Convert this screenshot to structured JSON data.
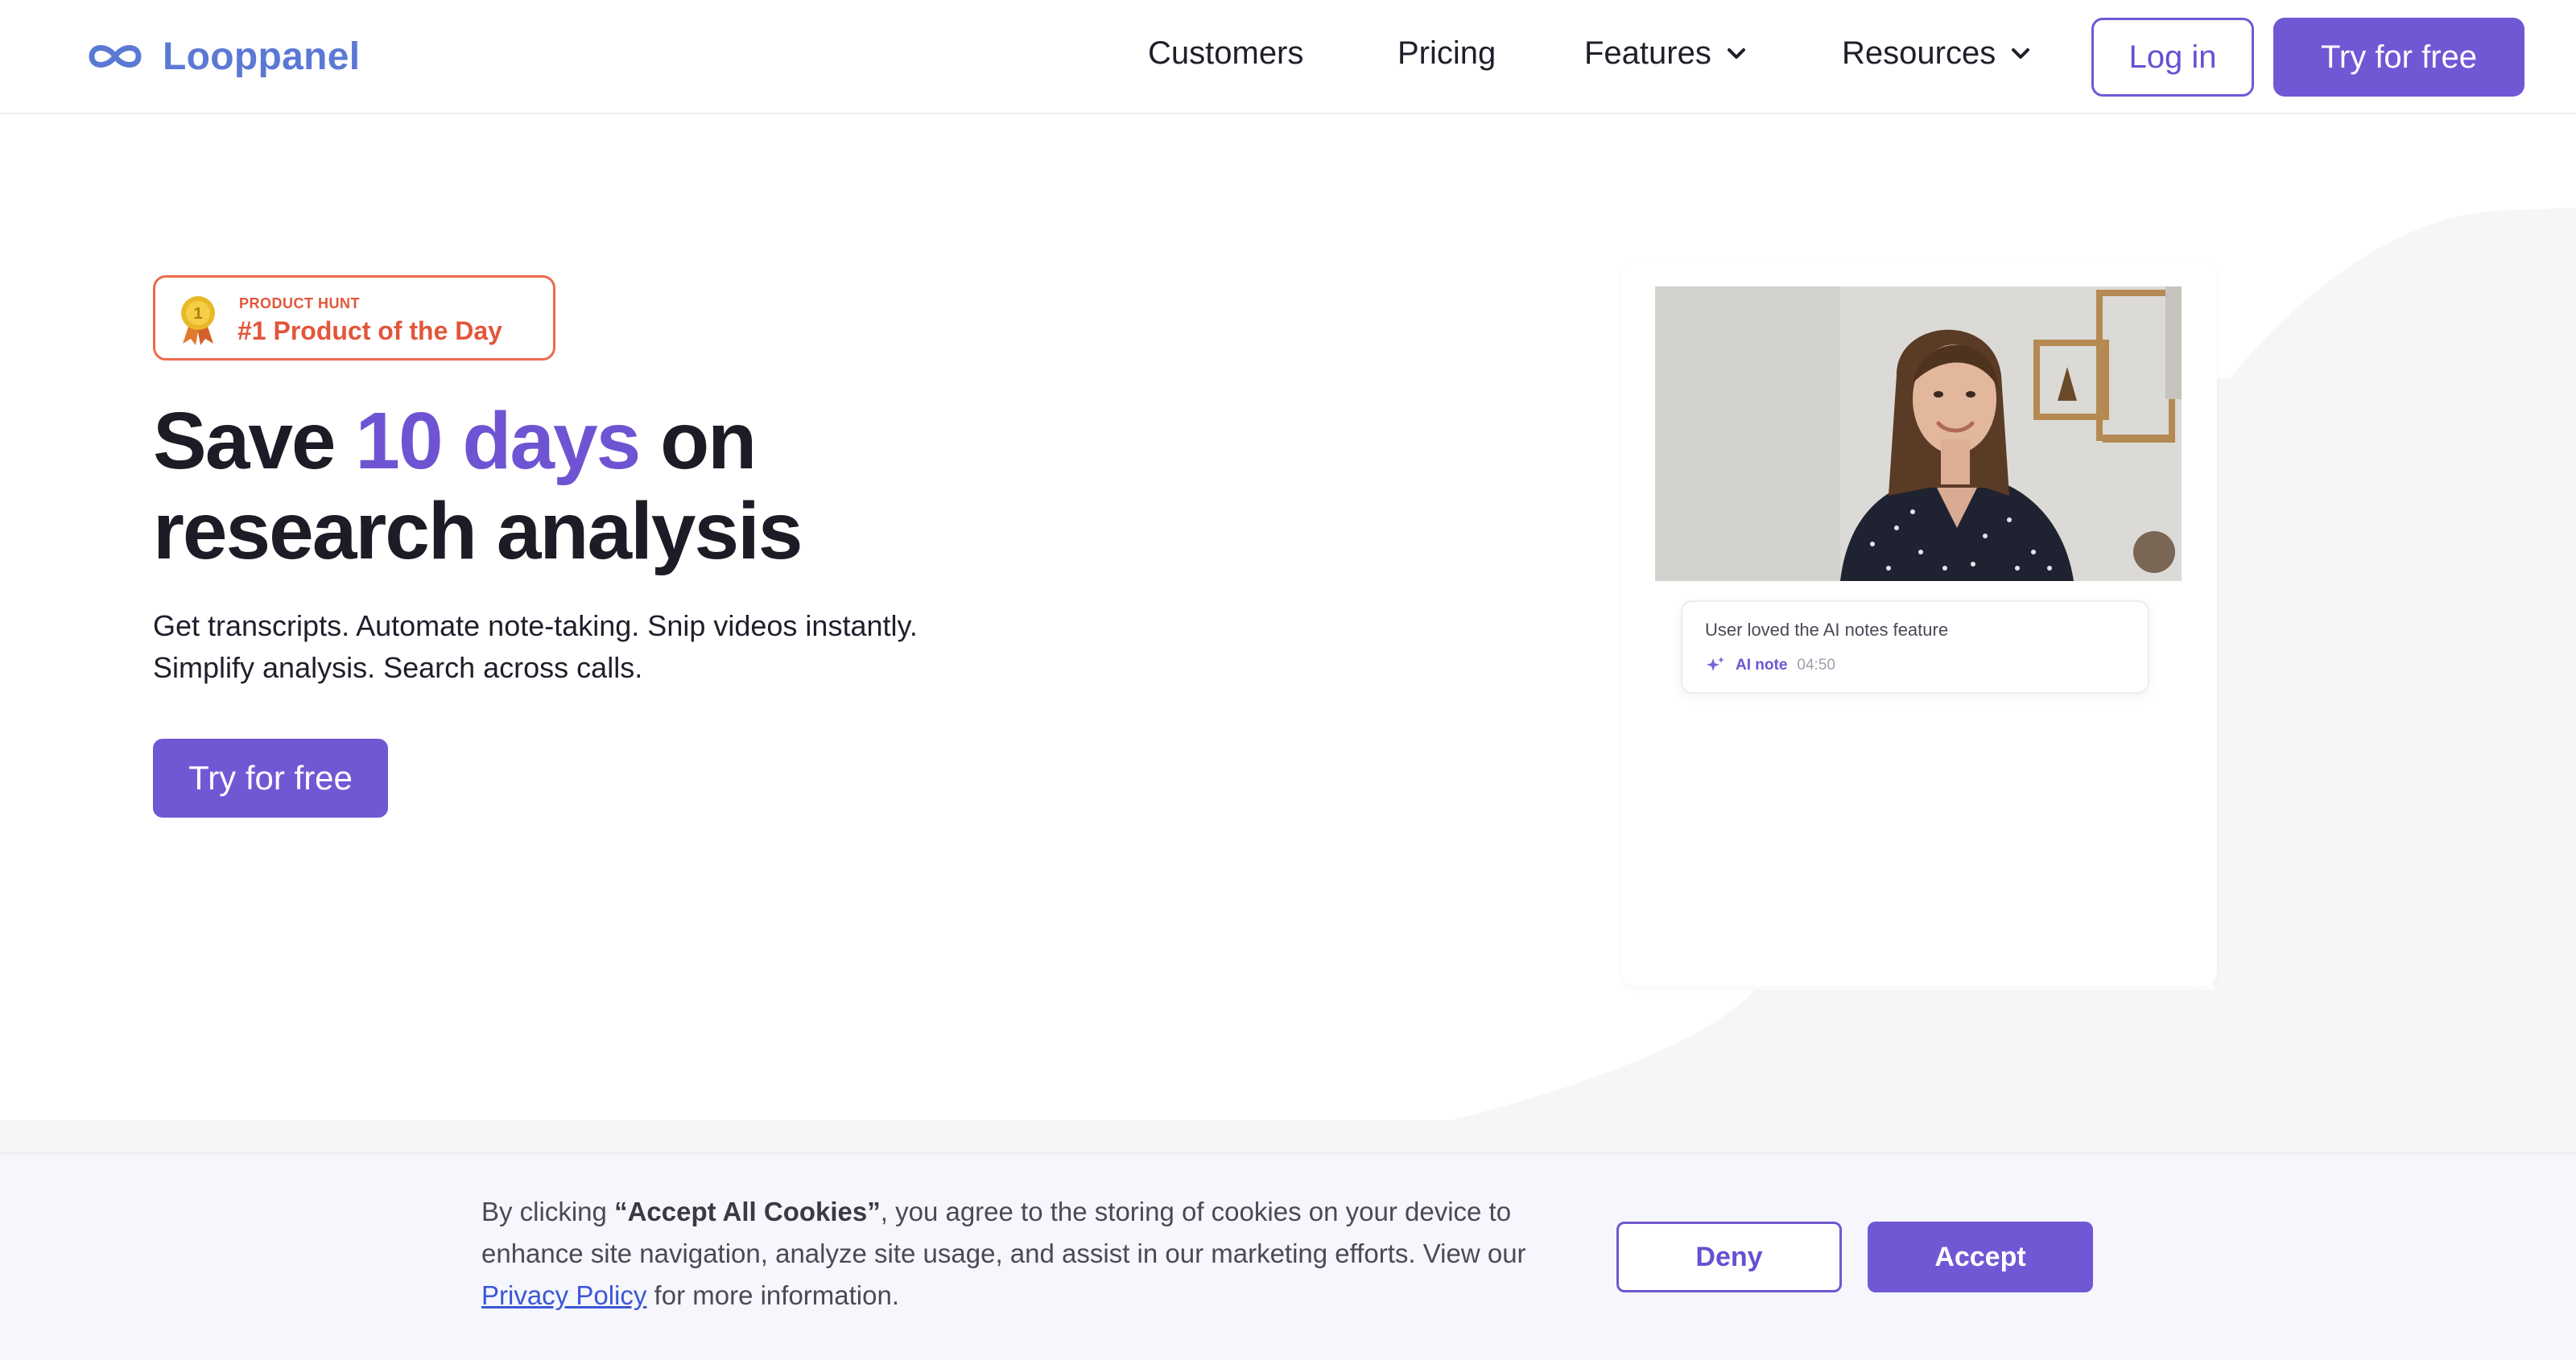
{
  "brand": {
    "name": "Looppanel",
    "logo_icon": "infinity-loop-icon",
    "color": "#5b79d4"
  },
  "nav": {
    "items": [
      {
        "label": "Customers"
      },
      {
        "label": "Pricing"
      },
      {
        "label": "Features",
        "icon": "chevron-down-icon"
      },
      {
        "label": "Resources",
        "icon": "chevron-down-icon"
      }
    ],
    "login_label": "Log in",
    "cta_label": "Try for free"
  },
  "hero": {
    "badge": {
      "kicker": "PRODUCT HUNT",
      "title": "#1 Product of the Day",
      "medal_number": "1",
      "icon": "medal-icon"
    },
    "headline": {
      "line1_prefix": "Save ",
      "highlight": "10 days",
      "line1_suffix": " on",
      "line2": "research analysis"
    },
    "subtext_line1": "Get transcripts. Automate note-taking. Snip videos instantly.",
    "subtext_line2": "Simplify analysis. Search across calls.",
    "cta_label": "Try for free"
  },
  "video_card": {
    "note_text": "User loved the AI notes feature",
    "note_tag": "AI note",
    "note_time": "04:50",
    "note_icon": "sparkle-icon"
  },
  "cookie": {
    "text_before": "By clicking ",
    "text_bold": "“Accept All Cookies”",
    "text_after": ", you agree to the storing of cookies on your device to enhance site navigation, analyze site usage, and assist in our marketing efforts. View our ",
    "link_label": "Privacy Policy",
    "text_end": " for more information.",
    "deny_label": "Deny",
    "accept_label": "Accept"
  },
  "colors": {
    "accent": "#7058d5",
    "badge": "#e2563a",
    "text": "#1c1c26"
  }
}
